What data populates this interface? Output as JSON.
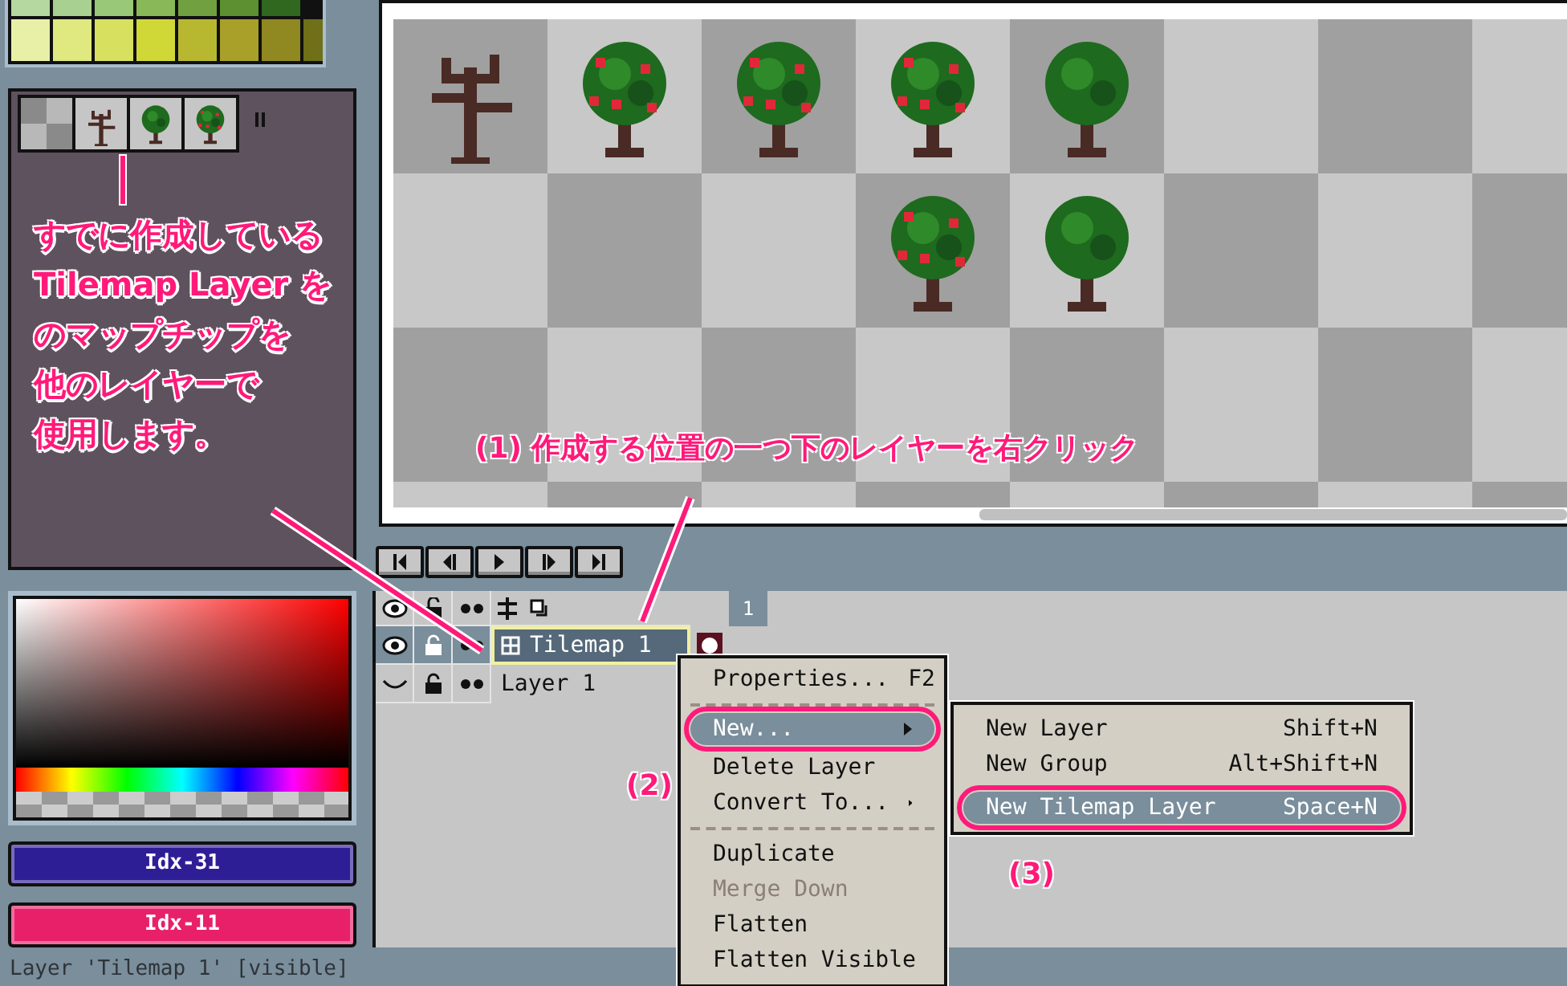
{
  "tileset": {
    "note_lines": [
      "すでに作成している",
      "Tilemap Layer を",
      "のマップチップを",
      "他のレイヤーで",
      "使用します。"
    ]
  },
  "color_bars": [
    {
      "label": "Idx-31",
      "color": "#2e1e96"
    },
    {
      "label": "Idx-11",
      "color": "#e8206a"
    }
  ],
  "timeline": {
    "frame": "1",
    "layers": [
      {
        "name": "Tilemap 1",
        "kind": "tilemap",
        "selected": true,
        "visible": true
      },
      {
        "name": "Layer 1",
        "kind": "image",
        "selected": false,
        "visible": false
      }
    ]
  },
  "context_menu": {
    "items": [
      {
        "kind": "item",
        "label": "Properties...",
        "shortcut": "F2",
        "selected": false,
        "disabled": false,
        "submenu": false
      },
      {
        "kind": "separator"
      },
      {
        "kind": "item",
        "label": "New...",
        "selected": true,
        "disabled": false,
        "submenu": true
      },
      {
        "kind": "item",
        "label": "Delete Layer",
        "selected": false,
        "disabled": false,
        "submenu": false
      },
      {
        "kind": "item",
        "label": "Convert To...",
        "selected": false,
        "disabled": false,
        "submenu": true
      },
      {
        "kind": "separator"
      },
      {
        "kind": "item",
        "label": "Duplicate",
        "selected": false,
        "disabled": false,
        "submenu": false
      },
      {
        "kind": "item",
        "label": "Merge Down",
        "selected": false,
        "disabled": true,
        "submenu": false
      },
      {
        "kind": "item",
        "label": "Flatten",
        "selected": false,
        "disabled": false,
        "submenu": false
      },
      {
        "kind": "item",
        "label": "Flatten Visible",
        "selected": false,
        "disabled": false,
        "submenu": false
      }
    ]
  },
  "submenu": {
    "items": [
      {
        "label": "New Layer",
        "shortcut": "Shift+N",
        "selected": false
      },
      {
        "label": "New Group",
        "shortcut": "Alt+Shift+N",
        "selected": false
      },
      {
        "label": "New Tilemap Layer",
        "shortcut": "Space+N",
        "selected": true
      }
    ]
  },
  "annotations": [
    {
      "kind": "step",
      "text": "(1) 作成する位置の一つ下のレイヤーを右クリック"
    },
    {
      "kind": "step",
      "text": "(2)"
    },
    {
      "kind": "step",
      "text": "(3)"
    }
  ],
  "status_bar": {
    "text": "Layer 'Tilemap 1' [visible]"
  }
}
